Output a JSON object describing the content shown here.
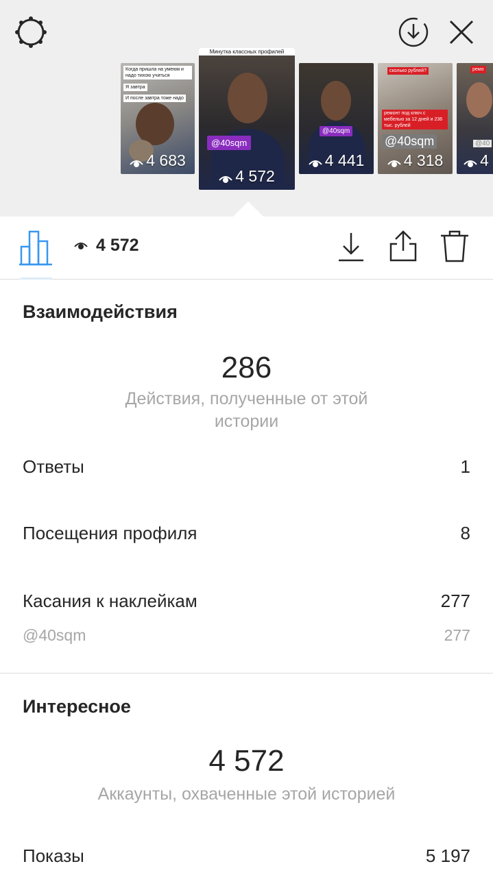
{
  "carousel": {
    "thumbnails": [
      {
        "views": "4 683",
        "captions": [
          "Когда пришла на умеюм и надо тихою учиться",
          "Я завтра",
          "И после завтра тоже надо"
        ]
      },
      {
        "views": "4 572",
        "title": "Минутка классных профилей",
        "tag": "@40sqm"
      },
      {
        "views": "4 441",
        "tag": "@40sqm"
      },
      {
        "views": "4 318",
        "tag": "@40sqm",
        "captions": [
          "сколько рублей?",
          "ремонт под ключ с мебелью за 12 дней и 236 тыс. рублей"
        ]
      },
      {
        "views": "4",
        "captions": [
          "ремо",
          "@40"
        ]
      }
    ]
  },
  "toolbar": {
    "views": "4 572"
  },
  "interactions": {
    "title": "Взаимодействия",
    "total": "286",
    "total_desc": "Действия, полученные от этой истории",
    "rows": [
      {
        "label": "Ответы",
        "value": "1"
      },
      {
        "label": "Посещения профиля",
        "value": "8"
      },
      {
        "label": "Касания к наклейкам",
        "value": "277"
      }
    ],
    "sub_row": {
      "label": "@40sqm",
      "value": "277"
    }
  },
  "discovery": {
    "title": "Интересное",
    "total": "4 572",
    "total_desc": "Аккаунты, охваченные этой историей",
    "rows": [
      {
        "label": "Показы",
        "value": "5 197"
      }
    ]
  },
  "colors": {
    "accent_blue": "#3897f0",
    "tag_purple": "#8a2dbf",
    "muted_text": "#a6a6a6"
  }
}
